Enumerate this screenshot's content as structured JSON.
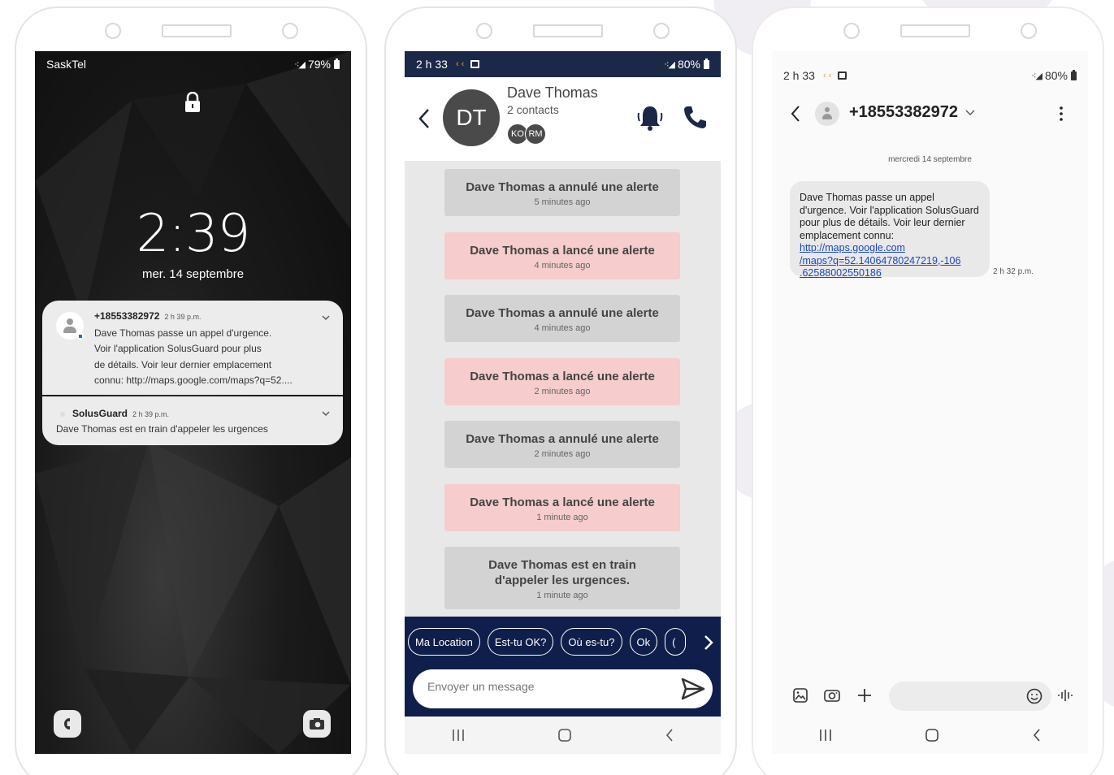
{
  "lockscreen": {
    "carrier": "SaskTel",
    "battery": "79%",
    "time": "2:39",
    "date": "mer. 14 septembre",
    "notifications": [
      {
        "sender": "+18553382972",
        "time": "2 h 39 p.m.",
        "lines": [
          "Dave Thomas passe un appel d'urgence.",
          "Voir l'application SolusGuard pour plus",
          "de détails. Voir leur dernier emplacement",
          "connu: http://maps.google.com/maps?q=52...."
        ]
      },
      {
        "sender": "SolusGuard",
        "time": "2 h 39 p.m.",
        "body": "Dave Thomas est en train d'appeler les urgences"
      }
    ]
  },
  "app": {
    "status_time": "2 h 33",
    "battery": "80%",
    "avatar_initials": "DT",
    "contact_name": "Dave Thomas",
    "contact_sub": "2 contacts",
    "member_initials": [
      "KO",
      "RM"
    ],
    "messages": [
      {
        "text": "Dave Thomas a annulé une alerte",
        "time": "5 minutes ago",
        "kind": "grey"
      },
      {
        "text": "Dave Thomas a lancé une alerte",
        "time": "4 minutes ago",
        "kind": "pink"
      },
      {
        "text": "Dave Thomas a annulé une alerte",
        "time": "4 minutes ago",
        "kind": "grey"
      },
      {
        "text": "Dave Thomas a lancé une alerte",
        "time": "2 minutes ago",
        "kind": "pink"
      },
      {
        "text": "Dave Thomas a annulé une alerte",
        "time": "2 minutes ago",
        "kind": "grey"
      },
      {
        "text": "Dave Thomas a lancé une alerte",
        "time": "1 minute ago",
        "kind": "pink"
      },
      {
        "text": "Dave Thomas est en train d'appeler les urgences.",
        "time": "1 minute ago",
        "kind": "grey"
      }
    ],
    "quick_replies": [
      "Ma Location",
      "Est-tu OK?",
      "Où es-tu?",
      "Ok",
      "("
    ],
    "input_placeholder": "Envoyer un message"
  },
  "sms": {
    "status_time": "2 h 33",
    "battery": "80%",
    "number": "+18553382972",
    "date_divider": "mercredi 14 septembre",
    "message_text": "Dave Thomas passe un appel d'urgence. Voir l'application SolusGuard pour plus de détails. Voir leur dernier emplacement connu: ",
    "message_link": "http://maps.google.com/maps?q=52.14064780247219,-106.62588002550186",
    "message_link_lines": [
      "http://maps.google.com",
      "/maps?q=52.14064780247219,-106",
      ".62588002550186"
    ],
    "message_time": "2 h 32 p.m."
  },
  "colors": {
    "app_header_dark": "#1c2847",
    "app_footer": "#0f1e4a",
    "alert_pink": "#f6cccc",
    "alert_grey": "#d3d3d3",
    "bell_blue": "#1c2847",
    "link_blue": "#1a47c9"
  }
}
